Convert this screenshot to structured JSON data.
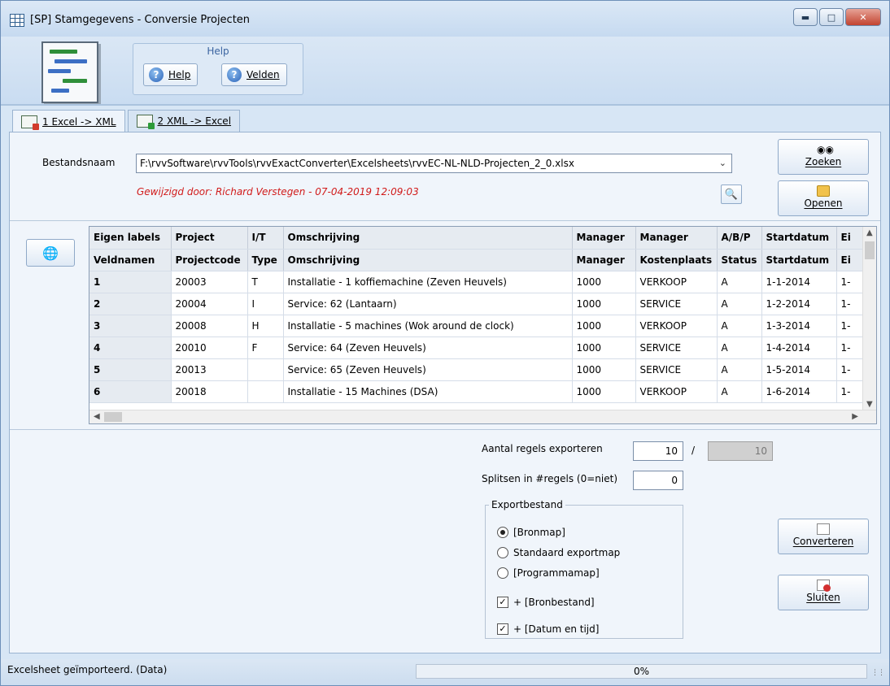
{
  "window": {
    "title": "[SP]  Stamgegevens - Conversie Projecten"
  },
  "ribbon": {
    "group_caption": "Help",
    "help_label": "Help",
    "fields_label": "Velden"
  },
  "tabs": [
    {
      "label": "1 Excel -> XML"
    },
    {
      "label": "2 XML -> Excel"
    }
  ],
  "file": {
    "label": "Bestandsnaam",
    "path": "F:\\rvvSoftware\\rvvTools\\rvvExactConverter\\Excelsheets\\rvvEC-NL-NLD-Projecten_2_0.xlsx",
    "changed_by": "Gewijzigd door: Richard Verstegen   -  07-04-2019  12:09:03",
    "search_label": "Zoeken",
    "open_label": "Openen"
  },
  "grid": {
    "header_labels": [
      "Eigen labels",
      "Project",
      "I/T",
      "Omschrijving",
      "Manager",
      "Manager",
      "A/B/P",
      "Startdatum",
      "Ei"
    ],
    "header_fields": [
      "Veldnamen",
      "Projectcode",
      "Type",
      "Omschrijving",
      "Manager",
      "Kostenplaats",
      "Status",
      "Startdatum",
      "Ei"
    ],
    "rows": [
      [
        "1",
        "20003",
        "T",
        "Installatie - 1 koffiemachine (Zeven Heuvels)",
        "1000",
        "VERKOOP",
        "A",
        "1-1-2014",
        "1-"
      ],
      [
        "2",
        "20004",
        "I",
        "Service: 62 (Lantaarn)",
        "1000",
        "SERVICE",
        "A",
        "1-2-2014",
        "1-"
      ],
      [
        "3",
        "20008",
        "H",
        "Installatie - 5 machines (Wok around de clock)",
        "1000",
        "VERKOOP",
        "A",
        "1-3-2014",
        "1-"
      ],
      [
        "4",
        "20010",
        "F",
        "Service: 64 (Zeven Heuvels)",
        "1000",
        "SERVICE",
        "A",
        "1-4-2014",
        "1-"
      ],
      [
        "5",
        "20013",
        "",
        "Service: 65 (Zeven Heuvels)",
        "1000",
        "SERVICE",
        "A",
        "1-5-2014",
        "1-"
      ],
      [
        "6",
        "20018",
        "",
        "Installatie - 15 Machines (DSA)",
        "1000",
        "VERKOOP",
        "A",
        "1-6-2014",
        "1-"
      ]
    ]
  },
  "export": {
    "rows_label": "Aantal regels exporteren",
    "rows_value": "10",
    "rows_separator": "/",
    "rows_total": "10",
    "split_label": "Splitsen in #regels (0=niet)",
    "split_value": "0",
    "group_label": "Exportbestand",
    "options": [
      {
        "label": "[Bronmap]",
        "selected": true
      },
      {
        "label": "Standaard exportmap",
        "selected": false
      },
      {
        "label": "[Programmamap]",
        "selected": false
      }
    ],
    "checks": [
      {
        "label": "+ [Bronbestand]",
        "checked": true
      },
      {
        "label": "+ [Datum en tijd]",
        "checked": true
      }
    ],
    "convert_label": "Converteren",
    "close_label": "Sluiten"
  },
  "status": {
    "text": "Excelsheet geïmporteerd. (Data)",
    "progress": "0%"
  }
}
